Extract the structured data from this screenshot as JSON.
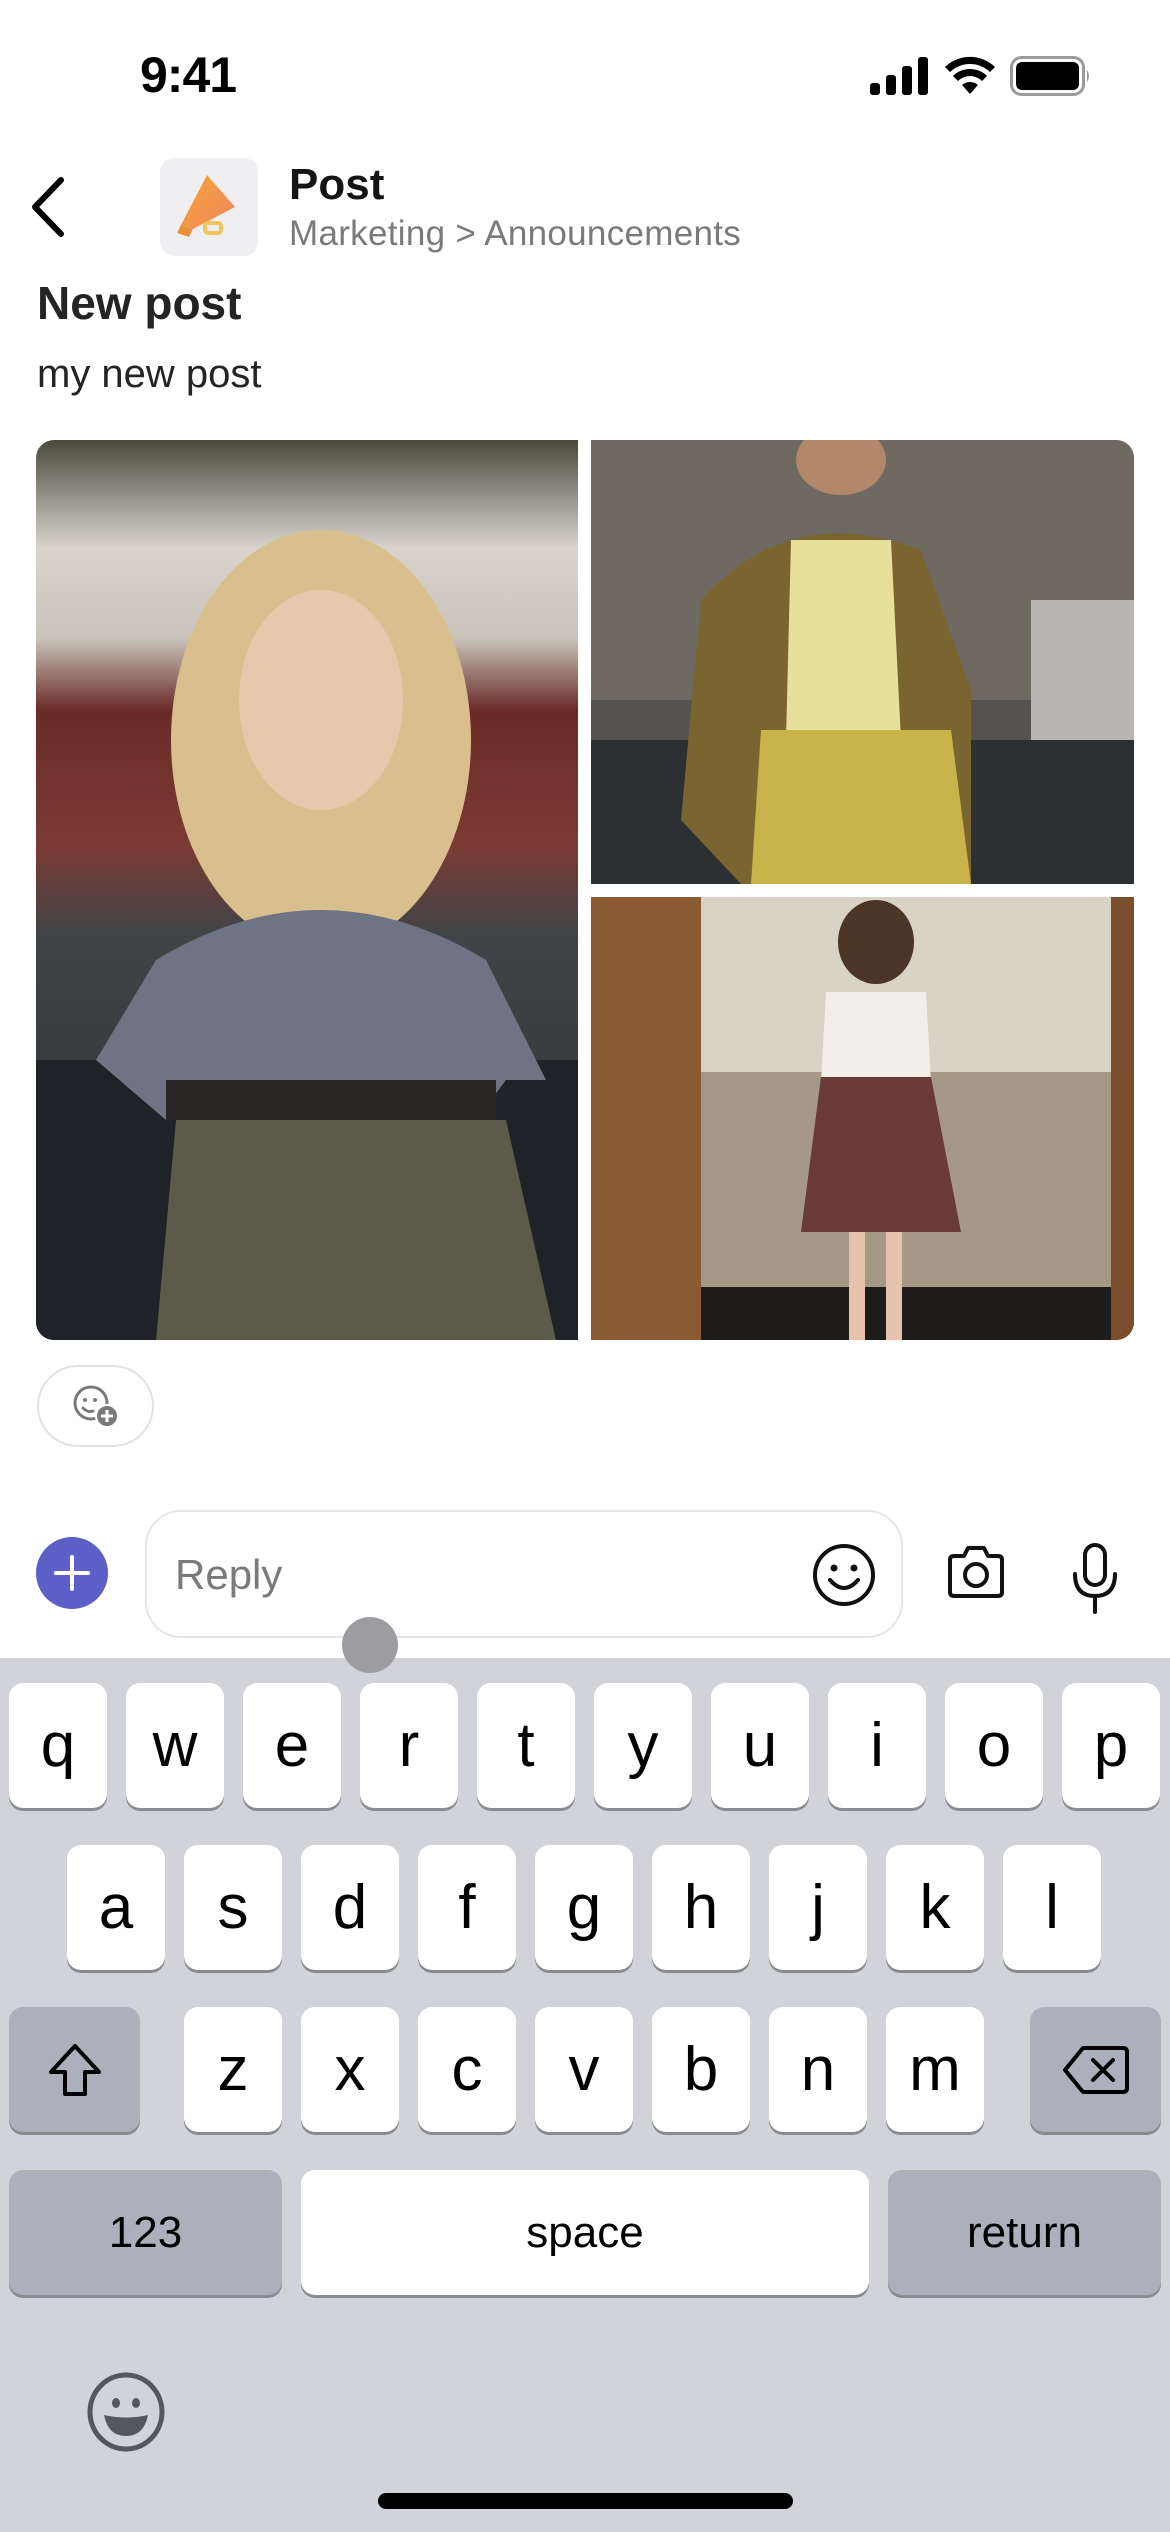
{
  "status_bar": {
    "time": "9:41",
    "icons": [
      "cellular-signal-icon",
      "wifi-icon",
      "battery-icon"
    ]
  },
  "header": {
    "back_icon": "chevron-left-icon",
    "avatar_icon": "megaphone-icon",
    "title": "Post",
    "subtitle": "Marketing > Announcements"
  },
  "post": {
    "title": "New post",
    "body": "my new post",
    "images": [
      {
        "alt": "Blonde woman in plaid crop shirt and olive skirt leaning on a car"
      },
      {
        "alt": "Woman in yellow plaid blazer and yellow blouse"
      },
      {
        "alt": "Woman in white blouse and brown plaid skirt standing by a wooden door"
      }
    ],
    "add_reaction_icon": "add-reaction-icon"
  },
  "composer": {
    "add_icon": "plus-icon",
    "reply_placeholder": "Reply",
    "reply_value": "",
    "emoji_icon": "smiley-icon",
    "camera_icon": "camera-icon",
    "mic_icon": "microphone-icon",
    "accent_color": "#5b5fc7"
  },
  "keyboard": {
    "row1": [
      "q",
      "w",
      "e",
      "r",
      "t",
      "y",
      "u",
      "i",
      "o",
      "p"
    ],
    "row2": [
      "a",
      "s",
      "d",
      "f",
      "g",
      "h",
      "j",
      "k",
      "l"
    ],
    "row3": [
      "z",
      "x",
      "c",
      "v",
      "b",
      "n",
      "m"
    ],
    "shift_icon": "shift-icon",
    "backspace_icon": "backspace-icon",
    "numbers_label": "123",
    "space_label": "space",
    "return_label": "return",
    "emoji_icon": "emoji-keyboard-icon"
  }
}
